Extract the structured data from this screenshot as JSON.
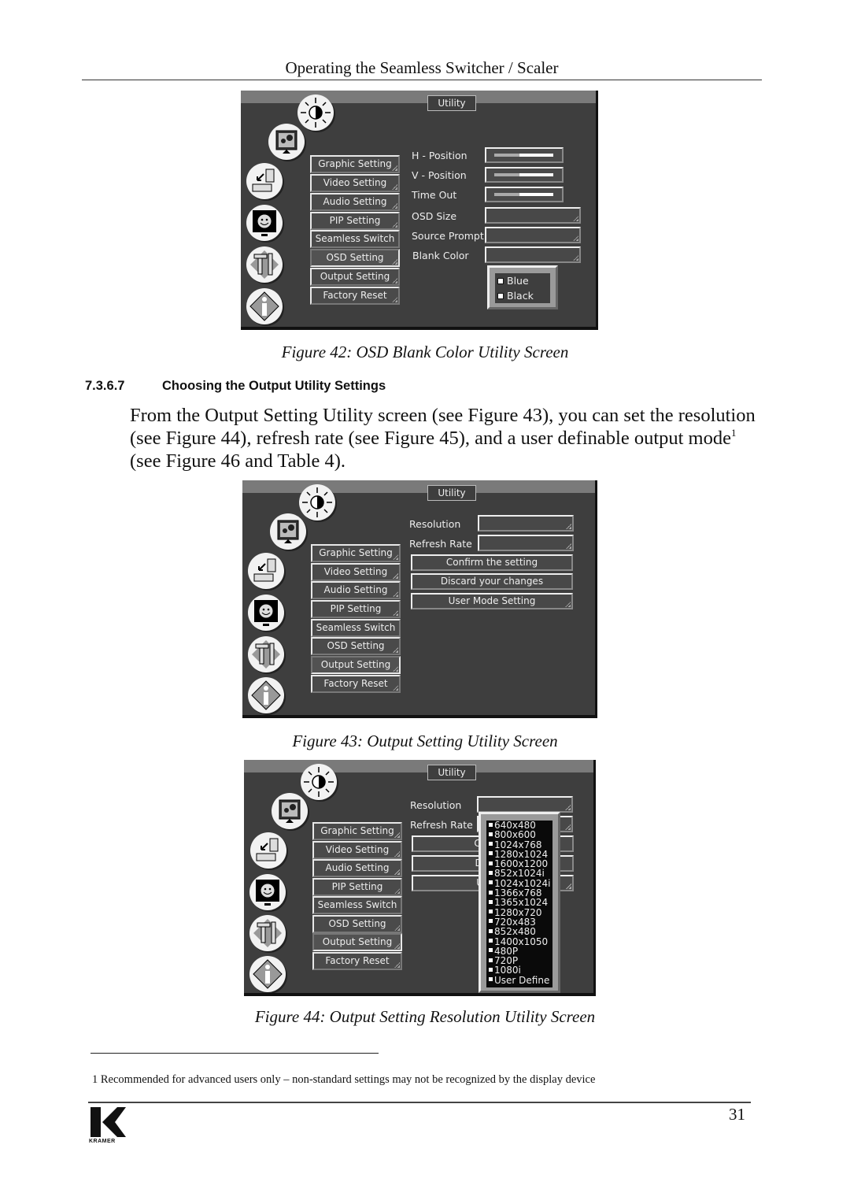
{
  "page": {
    "running_header": "Operating the Seamless Switcher / Scaler",
    "page_number": "31",
    "logo_text": "KRAMER"
  },
  "section": {
    "number": "7.3.6.7",
    "title": "Choosing the Output Utility Settings",
    "body_part1": "From the Output Setting Utility screen (see Figure 43), you can set the resolution (see Figure 44), refresh rate (see Figure 45), and a user definable output mode",
    "footnote_ref": "1",
    "body_part2": " (see Figure 46 and Table 4)."
  },
  "footnote": {
    "text": "1 Recommended for advanced users only – non-standard settings may not be recognized by the display device"
  },
  "menu": {
    "title": "Utility",
    "items": [
      "Graphic Setting",
      "Video Setting",
      "Audio Setting",
      "PIP Setting",
      "Seamless Switch",
      "OSD Setting",
      "Output Setting",
      "Factory Reset"
    ],
    "icons": [
      "brightness-icon",
      "picture-icon",
      "input-icon",
      "screen-adjust-icon",
      "tools-icon",
      "info-icon"
    ]
  },
  "figures": [
    {
      "caption": "Figure 42: OSD Blank Color Utility Screen",
      "active_item": "OSD Setting",
      "settings": [
        {
          "label": "H - Position",
          "type": "slider",
          "value": 0.42
        },
        {
          "label": "V - Position",
          "type": "slider",
          "value": 0.42
        },
        {
          "label": "Time Out",
          "type": "slider",
          "value": 0.42
        },
        {
          "label": "OSD Size",
          "type": "dropdown",
          "value": ""
        },
        {
          "label": "Source Prompt",
          "type": "dropdown",
          "value": ""
        },
        {
          "label": "Blank Color",
          "type": "dropdown",
          "value": ""
        }
      ],
      "popup_options": [
        "Blue",
        "Black"
      ]
    },
    {
      "caption": "Figure 43: Output Setting Utility Screen",
      "active_item": "Output Setting",
      "settings": [
        {
          "label": "Resolution",
          "type": "dropdown",
          "value": ""
        },
        {
          "label": "Refresh Rate",
          "type": "dropdown",
          "value": ""
        }
      ],
      "buttons": [
        "Confirm the setting",
        "Discard your changes",
        "User Mode Setting"
      ]
    },
    {
      "caption": "Figure 44: Output Setting Resolution Utility Screen",
      "active_item": "Output Setting",
      "settings": [
        {
          "label": "Resolution",
          "type": "dropdown",
          "value": ""
        },
        {
          "label": "Refresh Rate",
          "type": "dropdown",
          "value": ""
        }
      ],
      "buttons_partial": [
        "Confirm",
        "Discard",
        "User M"
      ],
      "resolution_options": [
        "640x480",
        "800x600",
        "1024x768",
        "1280x1024",
        "1600x1200",
        "852x1024i",
        "1024x1024i",
        "1366x768",
        "1365x1024",
        "1280x720",
        "720x483",
        "852x480",
        "1400x1050",
        "480P",
        "720P",
        "1080i",
        "User Define"
      ]
    }
  ]
}
